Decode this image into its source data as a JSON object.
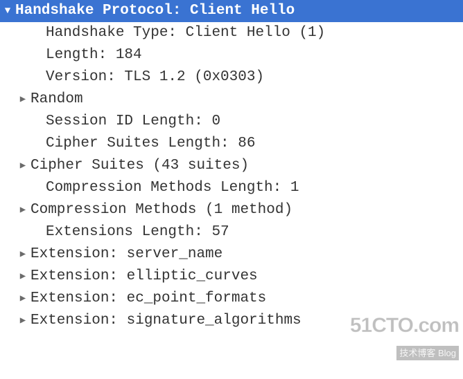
{
  "header": {
    "label": "Handshake Protocol: Client Hello"
  },
  "fields": [
    {
      "label": "Handshake Type: Client Hello (1)",
      "expandable": false,
      "indent": 2
    },
    {
      "label": "Length: 184",
      "expandable": false,
      "indent": 2
    },
    {
      "label": "Version: TLS 1.2 (0x0303)",
      "expandable": false,
      "indent": 2
    },
    {
      "label": "Random",
      "expandable": true,
      "indent": 1
    },
    {
      "label": "Session ID Length: 0",
      "expandable": false,
      "indent": 2
    },
    {
      "label": "Cipher Suites Length: 86",
      "expandable": false,
      "indent": 2
    },
    {
      "label": "Cipher Suites (43 suites)",
      "expandable": true,
      "indent": 1
    },
    {
      "label": "Compression Methods Length: 1",
      "expandable": false,
      "indent": 2
    },
    {
      "label": "Compression Methods (1 method)",
      "expandable": true,
      "indent": 1
    },
    {
      "label": "Extensions Length: 57",
      "expandable": false,
      "indent": 2
    },
    {
      "label": "Extension: server_name",
      "expandable": true,
      "indent": 1
    },
    {
      "label": "Extension: elliptic_curves",
      "expandable": true,
      "indent": 1
    },
    {
      "label": "Extension: ec_point_formats",
      "expandable": true,
      "indent": 1
    },
    {
      "label": "Extension: signature_algorithms",
      "expandable": true,
      "indent": 1
    }
  ],
  "watermark": {
    "line1": "51CTO.com",
    "line2": "技术博客  Blog"
  }
}
